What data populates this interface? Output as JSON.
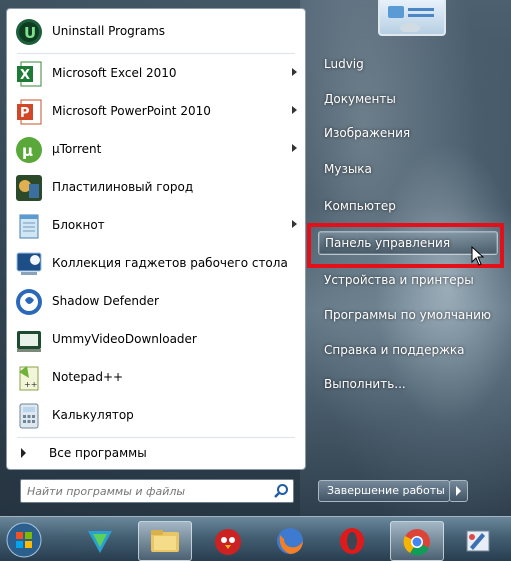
{
  "programs": [
    {
      "label": "Uninstall Programs",
      "icon": "iobit-uninstaller-icon",
      "has_submenu": false
    },
    {
      "label": "Microsoft Excel 2010",
      "icon": "excel-icon",
      "has_submenu": true
    },
    {
      "label": "Microsoft PowerPoint 2010",
      "icon": "powerpoint-icon",
      "has_submenu": true
    },
    {
      "label": "µTorrent",
      "icon": "utorrent-icon",
      "has_submenu": true
    },
    {
      "label": "Пластилиновый город",
      "icon": "plasticine-city-icon",
      "has_submenu": false
    },
    {
      "label": "Блокнот",
      "icon": "notepad-icon",
      "has_submenu": true
    },
    {
      "label": "Коллекция гаджетов рабочего стола",
      "icon": "gadgets-icon",
      "has_submenu": false
    },
    {
      "label": "Shadow Defender",
      "icon": "shadow-defender-icon",
      "has_submenu": false
    },
    {
      "label": "UmmyVideoDownloader",
      "icon": "ummy-icon",
      "has_submenu": false
    },
    {
      "label": "Notepad++",
      "icon": "notepad-plus-plus-icon",
      "has_submenu": false
    },
    {
      "label": "Калькулятор",
      "icon": "calculator-icon",
      "has_submenu": false
    }
  ],
  "all_programs_label": "Все программы",
  "search": {
    "placeholder": "Найти программы и файлы"
  },
  "right_items": [
    {
      "label": "Ludvig"
    },
    {
      "label": "Документы"
    },
    {
      "label": "Изображения"
    },
    {
      "label": "Музыка"
    },
    {
      "label": "Компьютер"
    },
    {
      "label": "Панель управления",
      "highlighted": true
    },
    {
      "label": "Устройства и принтеры"
    },
    {
      "label": "Программы по умолчанию"
    },
    {
      "label": "Справка и поддержка"
    },
    {
      "label": "Выполнить..."
    }
  ],
  "shutdown_label": "Завершение работы",
  "taskbar": [
    {
      "icon": "windows-start-icon"
    },
    {
      "icon": "shield-app-icon"
    },
    {
      "icon": "explorer-folder-icon",
      "active": true
    },
    {
      "icon": "angry-bird-icon"
    },
    {
      "icon": "firefox-icon"
    },
    {
      "icon": "opera-icon"
    },
    {
      "icon": "chrome-icon",
      "active": true
    },
    {
      "icon": "paint-icon"
    }
  ],
  "colors": {
    "highlight_box": "#e3101a",
    "text_white": "#ffffff"
  }
}
